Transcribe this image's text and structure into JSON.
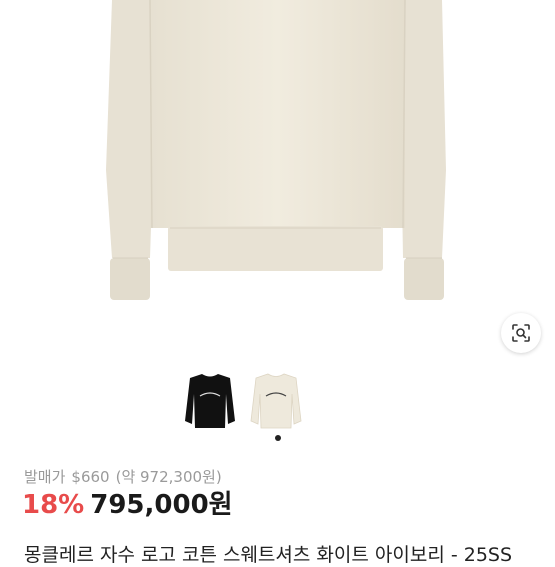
{
  "product": {
    "retail_label": "발매가",
    "retail_usd": "$660",
    "retail_krw": "(약 972,300원)",
    "discount": "18%",
    "price": "795,000원",
    "title": "몽클레르 자수 로고 코튼 스웨트셔츠 화이트 아이보리 - 25SS"
  },
  "icons": {
    "lens": "image-search-icon"
  },
  "gallery": {
    "thumbnails": [
      "black-sweatshirt",
      "ivory-sweatshirt"
    ],
    "selected_index": 1
  },
  "colors": {
    "discount": "#e84b4b",
    "price": "#1a1a1a",
    "retail": "#9a9a9a",
    "garment": "#efeadd"
  }
}
